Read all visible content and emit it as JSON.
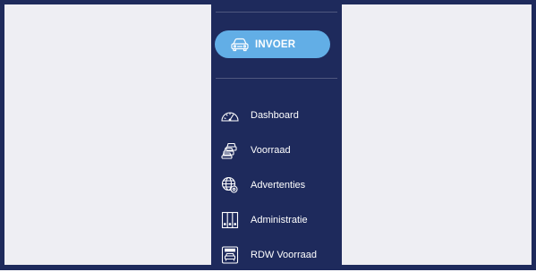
{
  "sidebar": {
    "invoer_button": {
      "label": "INVOER",
      "icon": "car-icon"
    },
    "items": [
      {
        "label": "Dashboard",
        "icon": "speedometer-icon"
      },
      {
        "label": "Voorraad",
        "icon": "cars-stack-icon"
      },
      {
        "label": "Advertenties",
        "icon": "globe-gear-icon"
      },
      {
        "label": "Administratie",
        "icon": "binders-icon"
      },
      {
        "label": "RDW Voorraad",
        "icon": "rdw-car-icon"
      }
    ]
  },
  "colors": {
    "sidebar_bg": "#1e2a5c",
    "accent": "#62aee6",
    "content_bg": "#eeeef3"
  }
}
